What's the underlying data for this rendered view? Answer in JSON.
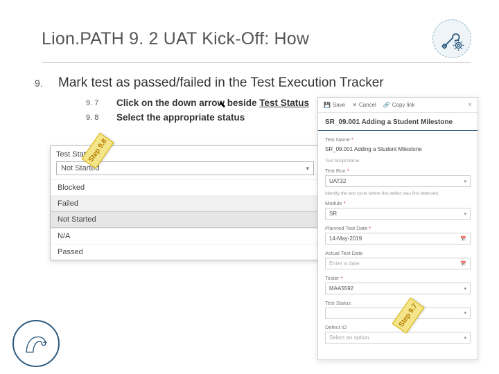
{
  "title": "Lion.PATH 9. 2 UAT Kick-Off: How",
  "step": {
    "num": "9.",
    "text": "Mark test as passed/failed in the Test Execution Tracker"
  },
  "substeps": [
    {
      "num": "9. 7",
      "pre": "Click on the down arrow beside ",
      "link": "Test Status"
    },
    {
      "num": "9. 8",
      "pre": "Select the appropriate status",
      "link": ""
    }
  ],
  "dropdown": {
    "label": "Test Status",
    "selected": "Not Started",
    "options": [
      "Blocked",
      "Failed",
      "Not Started",
      "N/A",
      "Passed"
    ]
  },
  "form": {
    "toolbar": {
      "save": "Save",
      "cancel": "Cancel",
      "copy": "Copy link"
    },
    "close": "×",
    "header": "SR_09.001 Adding a Student Milestone",
    "hint1": "Test Script Name",
    "hint2": "Identify the test cycle where the defect was first detected.",
    "fields": {
      "name": {
        "label": "Test Name",
        "req": "*",
        "value": "SR_09.001 Adding a Student Milestone"
      },
      "run": {
        "label": "Test Run",
        "req": "*",
        "value": "UAT32"
      },
      "module": {
        "label": "Module",
        "req": "*",
        "value": "SR"
      },
      "planned": {
        "label": "Planned Test Date",
        "req": "*",
        "value": "14-May-2019"
      },
      "actual": {
        "label": "Actual Test Date",
        "req": "",
        "value": "Enter a date"
      },
      "tester": {
        "label": "Tester",
        "req": "*",
        "value": "MAA5592"
      },
      "status": {
        "label": "Test Status",
        "req": "",
        "value": ""
      },
      "defect": {
        "label": "Defect ID",
        "req": "",
        "value": "Select an option"
      }
    }
  },
  "callouts": {
    "left": "Step 9.8",
    "right": "Step 9.7"
  },
  "icons": {
    "wrench": "wrench-gear-icon",
    "lion": "lion-logo"
  }
}
